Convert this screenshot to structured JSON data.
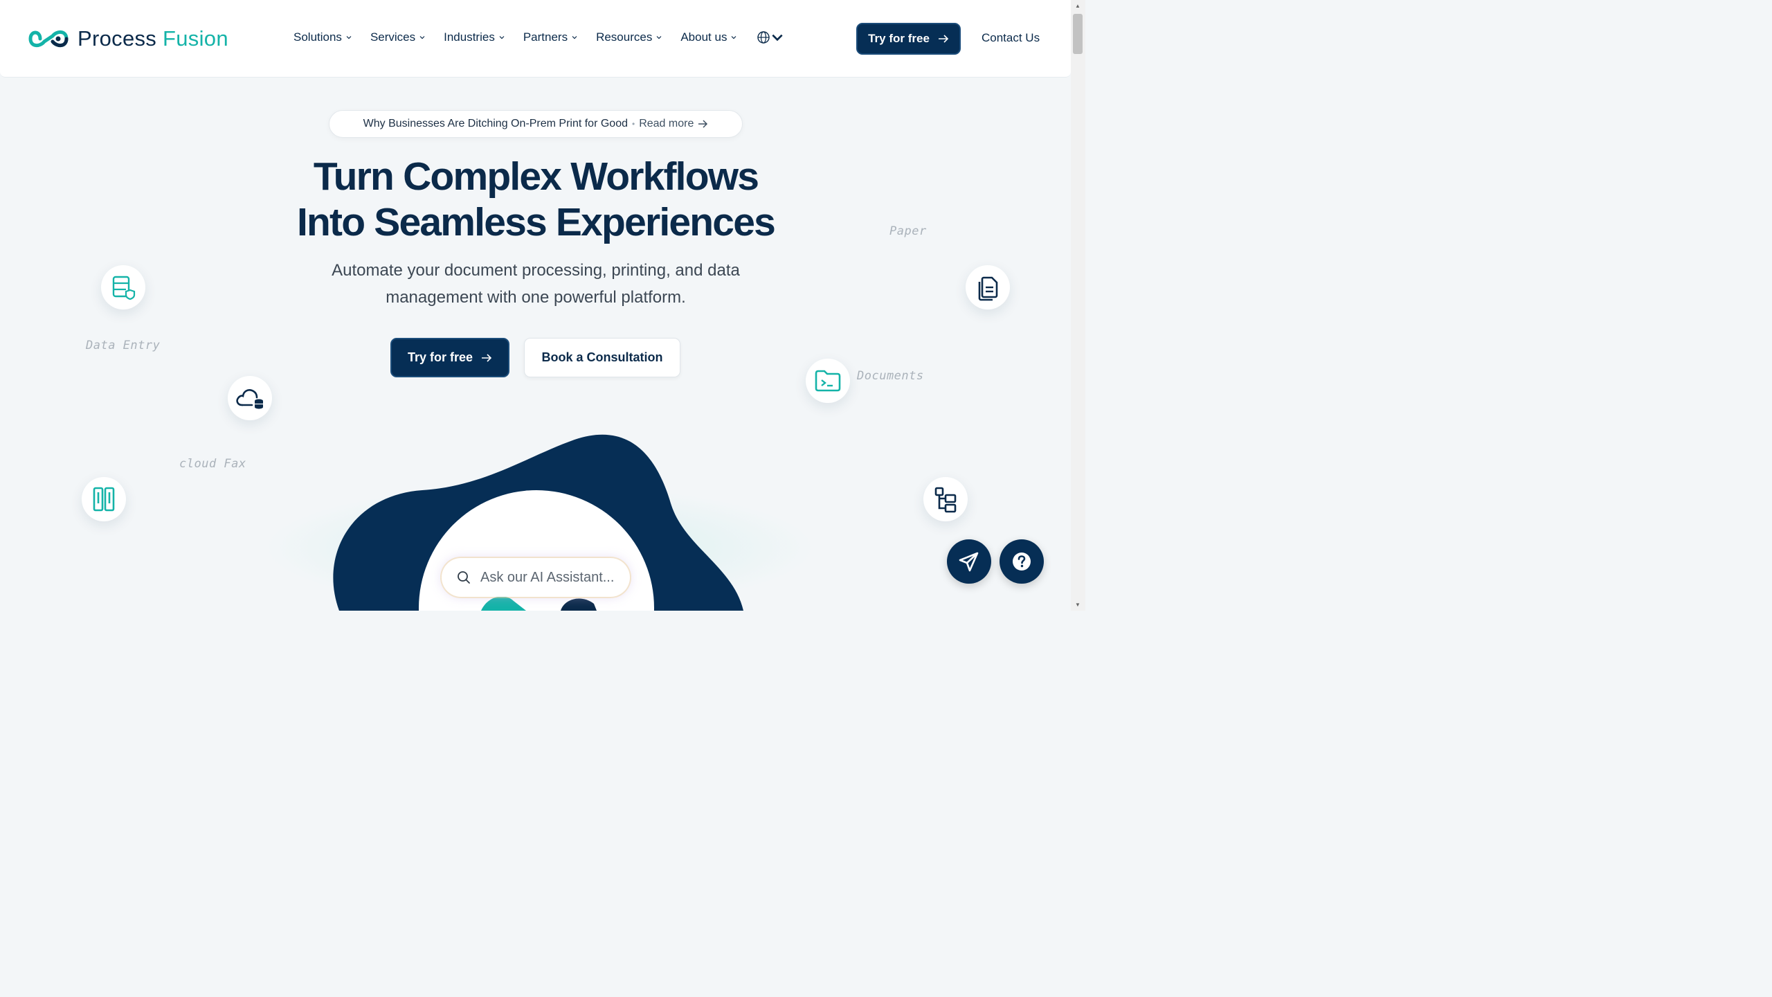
{
  "brand": {
    "name_part1": "Process",
    "name_part2": "Fusion",
    "primary_color": "#062e55",
    "accent_color": "#14b3a8"
  },
  "nav": {
    "items": [
      {
        "label": "Solutions"
      },
      {
        "label": "Services"
      },
      {
        "label": "Industries"
      },
      {
        "label": "Partners"
      },
      {
        "label": "Resources"
      },
      {
        "label": "About us"
      }
    ],
    "language_icon": "globe-icon",
    "try_label": "Try for free",
    "contact_label": "Contact Us"
  },
  "announcement": {
    "text": "Why Businesses Are Ditching On-Prem Print for Good",
    "separator": "•",
    "link": "Read more"
  },
  "hero": {
    "headline_line1": "Turn Complex Workflows",
    "headline_line2": "Into Seamless Experiences",
    "subhead_line1": "Automate your document processing, printing, and data",
    "subhead_line2": "management with one powerful platform.",
    "primary_cta": "Try for free",
    "secondary_cta": "Book a Consultation"
  },
  "floating": {
    "labels": {
      "data_entry": "Data Entry",
      "cloud_fax": "cloud Fax",
      "paper": "Paper",
      "documents": "Documents"
    },
    "icons": [
      "database-shield-icon",
      "cloud-storage-icon",
      "binders-icon",
      "files-icon",
      "folder-terminal-icon",
      "sitemap-icon"
    ]
  },
  "ai_assistant": {
    "placeholder": "Ask our AI Assistant..."
  },
  "fabs": [
    "send-icon",
    "help-icon"
  ]
}
